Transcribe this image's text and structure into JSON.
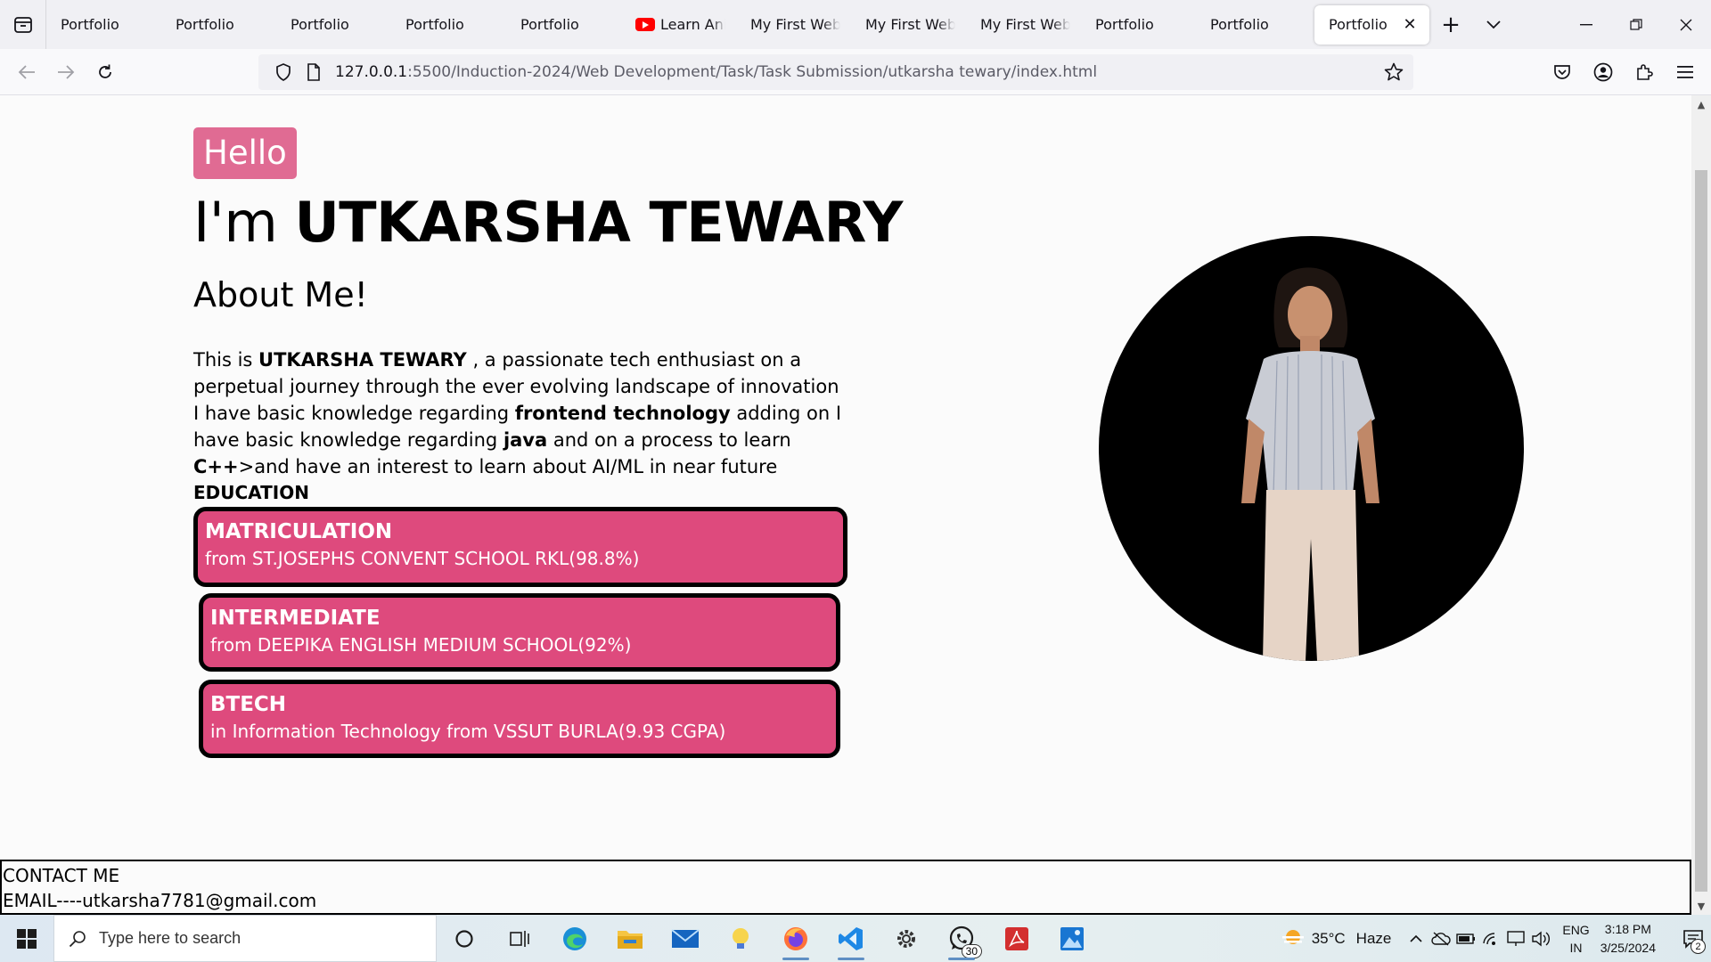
{
  "browser": {
    "tabs": [
      {
        "title": "Portfolio",
        "favicon": "none"
      },
      {
        "title": "Portfolio",
        "favicon": "none"
      },
      {
        "title": "Portfolio",
        "favicon": "none"
      },
      {
        "title": "Portfolio",
        "favicon": "none"
      },
      {
        "title": "Portfolio",
        "favicon": "none"
      },
      {
        "title": "Learn Anim",
        "favicon": "youtube-icon"
      },
      {
        "title": "My First Websit",
        "favicon": "none"
      },
      {
        "title": "My First Websit",
        "favicon": "none"
      },
      {
        "title": "My First Websit",
        "favicon": "none"
      },
      {
        "title": "Portfolio",
        "favicon": "none"
      },
      {
        "title": "Portfolio",
        "favicon": "none"
      },
      {
        "title": "Portfolio",
        "favicon": "none",
        "active": true
      }
    ],
    "url_host": "127.0.0.1",
    "url_rest": ":5500/Induction-2024/Web Development/Task/Task Submission/utkarsha tewary/index.html"
  },
  "page": {
    "hello": "Hello",
    "name_prefix": "I'm ",
    "name": "UTKARSHA TEWARY",
    "about_title": "About Me!",
    "about": {
      "p1_a": "This is ",
      "p1_name": "UTKARSHA TEWARY",
      "p1_b": " , a passionate tech enthusiast on a perpetual journey through the ever evolving landscape of innovation",
      "p2_a": "I have basic knowledge regarding ",
      "p2_frontend": "frontend technology",
      "p2_b": " adding on I have basic knowledge regarding ",
      "p2_java": "java",
      "p2_c": " and on a process to learn ",
      "p2_cpp": "C++",
      "p2_d": ">and have an interest to learn about AI/ML in near future"
    },
    "education_label": "EDUCATION",
    "education": [
      {
        "title": "MATRICULATION",
        "desc": "from ST.JOSEPHS CONVENT SCHOOL RKL(98.8%)"
      },
      {
        "title": "INTERMEDIATE",
        "desc": "from DEEPIKA ENGLISH MEDIUM SCHOOL(92%)"
      },
      {
        "title": "BTECH",
        "desc": "in Information Technology from VSSUT BURLA(9.93 CGPA)"
      }
    ],
    "contact_title": "CONTACT ME",
    "contact_email": "EMAIL----utkarsha7781@gmail.com",
    "colors": {
      "accent": "#de4a7d",
      "hello_bg": "#e06b93",
      "photo_bg": "#000000"
    }
  },
  "taskbar": {
    "search_placeholder": "Type here to search",
    "whatsapp_badge": "30",
    "weather_temp": "35°C",
    "weather_cond": "Haze",
    "lang_1": "ENG",
    "lang_2": "IN",
    "time": "3:18 PM",
    "date": "3/25/2024",
    "notifications": "2"
  }
}
